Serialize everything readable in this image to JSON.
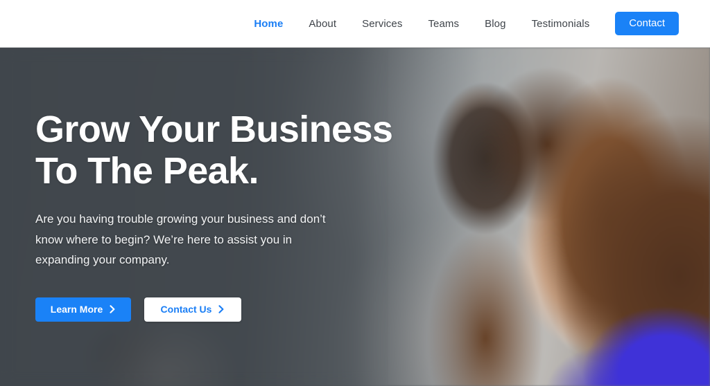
{
  "header": {
    "nav": [
      {
        "label": "Home",
        "active": true
      },
      {
        "label": "About",
        "active": false
      },
      {
        "label": "Services",
        "active": false
      },
      {
        "label": "Teams",
        "active": false
      },
      {
        "label": "Blog",
        "active": false
      },
      {
        "label": "Testimonials",
        "active": false
      }
    ],
    "contact_button": "Contact"
  },
  "hero": {
    "title": "Grow Your Business\nTo The Peak.",
    "subtitle": "Are you having trouble growing your business and don’t\nknow where to begin? We’re here to assist you in\nexpanding your company.",
    "primary_cta": "Learn More",
    "secondary_cta": "Contact Us",
    "cta_icon": "chevron-right-icon"
  },
  "colors": {
    "accent": "#1a82f7",
    "accent_link": "#1a7ef5",
    "nav_text": "#3f444a",
    "header_bg": "#ffffff",
    "hero_overlay": "#3a4046",
    "hero_text": "#ffffff"
  }
}
